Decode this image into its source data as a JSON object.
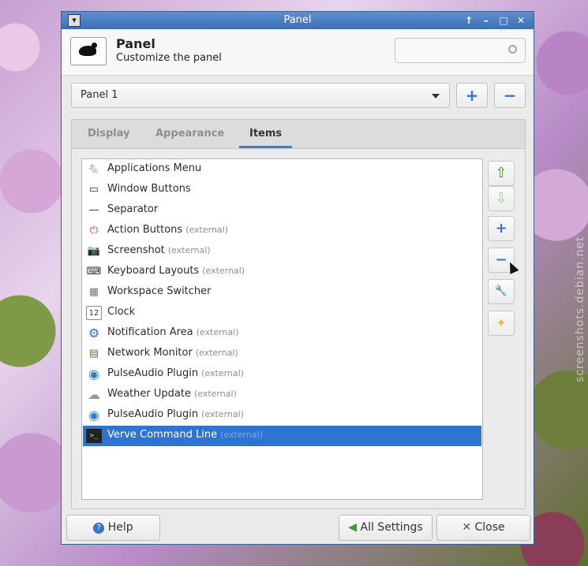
{
  "window": {
    "title": "Panel",
    "controls": {
      "up": "↑",
      "minimize": "–",
      "maximize": "□",
      "close": "✕"
    }
  },
  "header": {
    "title": "Panel",
    "subtitle": "Customize the panel",
    "search": {
      "value": "",
      "placeholder": ""
    }
  },
  "panel_selector": {
    "value": "Panel 1",
    "add_symbol": "+",
    "remove_symbol": "−"
  },
  "tabs": [
    {
      "label": "Display",
      "active": false
    },
    {
      "label": "Appearance",
      "active": false
    },
    {
      "label": "Items",
      "active": true
    }
  ],
  "items": [
    {
      "label": "Applications Menu",
      "external": "",
      "icon": "mouse-icon",
      "glyph": "🐁"
    },
    {
      "label": "Window Buttons",
      "external": "",
      "icon": "window-buttons-icon",
      "glyph": "▭"
    },
    {
      "label": "Separator",
      "external": "",
      "icon": "separator-icon",
      "glyph": "—"
    },
    {
      "label": "Action Buttons",
      "external": "(external)",
      "icon": "action-buttons-icon",
      "glyph": "⏻"
    },
    {
      "label": "Screenshot",
      "external": "(external)",
      "icon": "camera-icon",
      "glyph": "📷"
    },
    {
      "label": "Keyboard Layouts",
      "external": "(external)",
      "icon": "keyboard-icon",
      "glyph": "⌨"
    },
    {
      "label": "Workspace Switcher",
      "external": "",
      "icon": "workspace-icon",
      "glyph": "▦"
    },
    {
      "label": "Clock",
      "external": "",
      "icon": "calendar-icon",
      "glyph": "12"
    },
    {
      "label": "Notification Area",
      "external": "(external)",
      "icon": "gear-icon",
      "glyph": "⚙"
    },
    {
      "label": "Network Monitor",
      "external": "(external)",
      "icon": "network-icon",
      "glyph": "▤"
    },
    {
      "label": "PulseAudio Plugin",
      "external": "(external)",
      "icon": "audio-icon",
      "glyph": "◉"
    },
    {
      "label": "Weather Update",
      "external": "(external)",
      "icon": "weather-icon",
      "glyph": "☁"
    },
    {
      "label": "PulseAudio Plugin",
      "external": "(external)",
      "icon": "audio-icon",
      "glyph": "◉"
    },
    {
      "label": "Verve Command Line",
      "external": "(external)",
      "icon": "terminal-icon",
      "glyph": ">_",
      "selected": true
    }
  ],
  "side_buttons": {
    "move_up": "⇧",
    "move_down": "⇩",
    "add": "+",
    "remove": "−",
    "edit": "🔧",
    "about": "✦"
  },
  "footer": {
    "help": "Help",
    "all_settings": "All Settings",
    "close": "Close",
    "help_icon": "?",
    "all_settings_icon": "◀",
    "close_icon": "✕"
  },
  "watermark": "screenshots.debian.net",
  "colors": {
    "accent": "#2f74d0",
    "titlebar": "#4a7cc0",
    "arrow_up": "#3f9a2f"
  }
}
